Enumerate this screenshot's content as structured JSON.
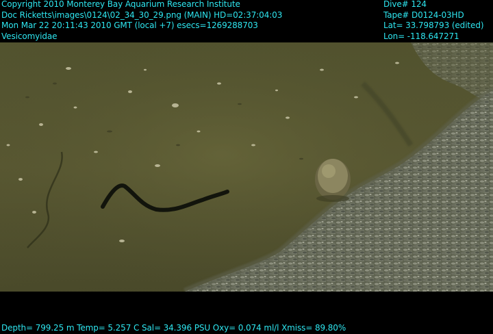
{
  "overlay": {
    "top_left": [
      "Copyright 2010 Monterey Bay Aquarium Research Institute",
      "Doc Ricketts\\images\\0124\\02_34_30_29.png (MAIN)  HD=02:37:04:03",
      "Mon Mar 22 20:11:43 2010 GMT (local +7)  esecs=1269288703",
      "Vesicomyidae"
    ],
    "top_right": [
      "Dive# 124",
      "Tape# D0124-03HD",
      "Lat= 33.798793 (edited)",
      "Lon= -118.647271"
    ],
    "bottom": "Depth= 799.25 m  Temp= 5.257 C  Sal= 34.396 PSU  Oxy= 0.074 ml/l  Xmiss= 89.80%"
  },
  "colors": {
    "overlay_text": "#2ee6f0",
    "seafloor": "#5a5a34",
    "clam_bed": "#6f7360",
    "crack": "#12140c"
  }
}
